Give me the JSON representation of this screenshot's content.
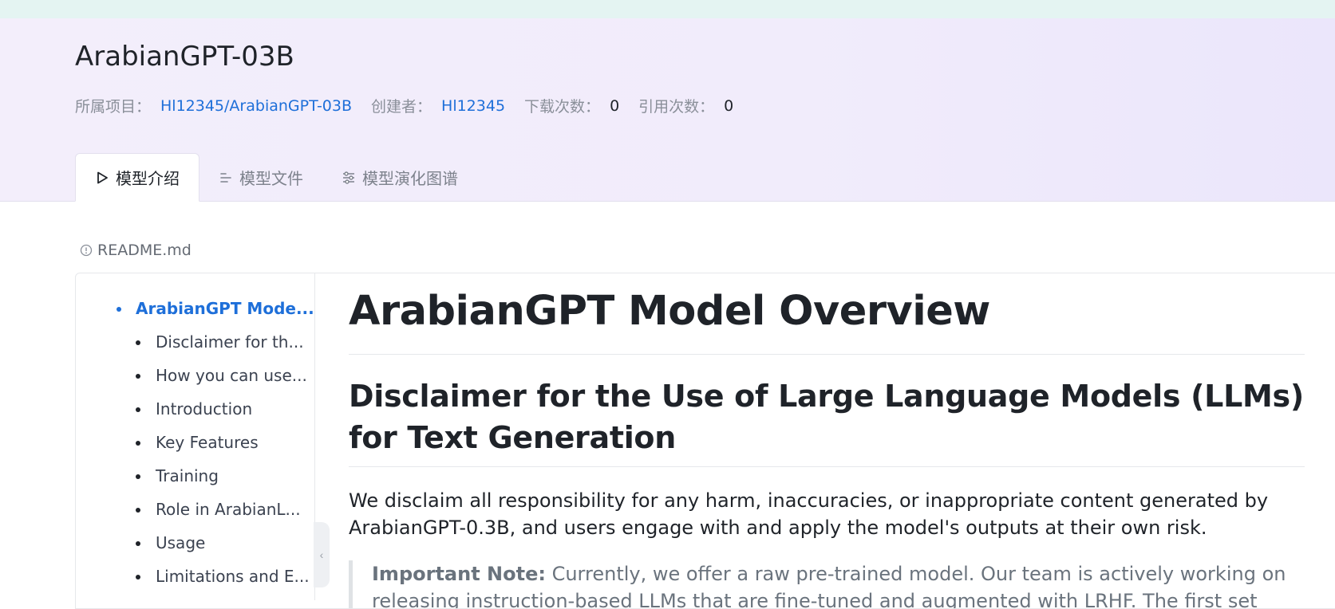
{
  "model": {
    "title": "ArabianGPT-03B",
    "project_label": "所属项目：",
    "project_value": "Hl12345/ArabianGPT-03B",
    "creator_label": "创建者：",
    "creator_value": "Hl12345",
    "downloads_label": "下载次数：",
    "downloads_value": "0",
    "citations_label": "引用次数：",
    "citations_value": "0"
  },
  "tabs": [
    {
      "label": "模型介绍",
      "icon": "play-icon",
      "active": true
    },
    {
      "label": "模型文件",
      "icon": "file-lines-icon",
      "active": false
    },
    {
      "label": "模型演化图谱",
      "icon": "sliders-icon",
      "active": false
    }
  ],
  "readme": {
    "label": "README.md",
    "icon": "info-circle-icon"
  },
  "toc": {
    "items": [
      "ArabianGPT Mode...",
      "Disclaimer for th...",
      "How you can use...",
      "Introduction",
      "Key Features",
      "Training",
      "Role in ArabianL...",
      "Usage",
      "Limitations and E..."
    ]
  },
  "doc": {
    "h1": "ArabianGPT Model Overview",
    "h2": "Disclaimer for the Use of Large Language Models (LLMs) for Text Generation",
    "para": "We disclaim all responsibility for any harm, inaccuracies, or inappropriate content generated by ArabianGPT-0.3B, and users engage with and apply the model's outputs at their own risk.",
    "note_label": "Important Note:",
    "note_text": " Currently, we offer a raw pre-trained model. Our team is actively working on releasing instruction-based LLMs that are fine-tuned and augmented with LRHF. The first set"
  },
  "colors": {
    "link": "#1e6fd9",
    "header_bg": "#f3eefb",
    "top_strip": "#e4f4f2"
  }
}
